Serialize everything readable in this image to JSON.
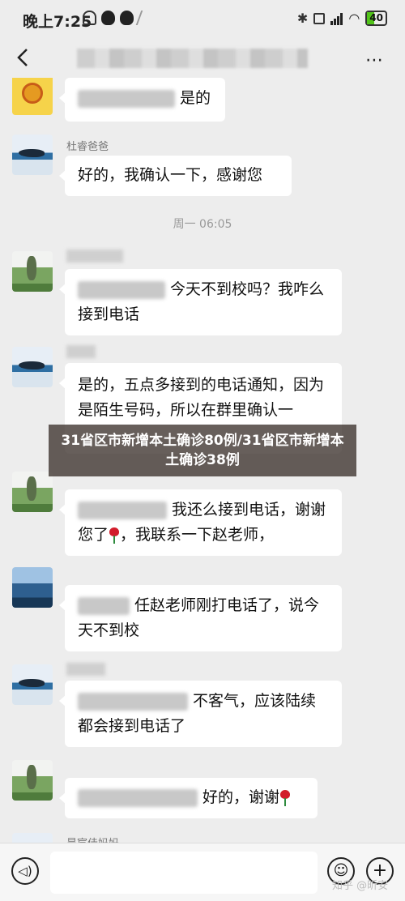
{
  "status_bar": {
    "time": "晚上7:25",
    "battery": "40"
  },
  "header": {
    "more_icon": "⋯"
  },
  "messages": [
    {
      "sender": "",
      "text_tail": "是的"
    },
    {
      "sender": "杜睿爸爸",
      "text": "好的，我确认一下，感谢您"
    },
    {
      "sender": "",
      "text_tail": "今天不到校吗？我咋么接到电话"
    },
    {
      "sender": "",
      "text": "是的，五点多接到的电话通知，因为是陌生号码，所以在群里确认一"
    },
    {
      "sender": "",
      "text_tail": "我还么接到电话，谢谢您了",
      "text_tail2": "，我联系一下赵老师，"
    },
    {
      "sender": "",
      "text_tail": "任赵老师刚打电话了，说今天不到校"
    },
    {
      "sender": "",
      "text_tail": "不客气，应该陆续都会接到电话了"
    },
    {
      "sender": "",
      "text_tail": "好的，谢谢"
    },
    {
      "sender": "昊宸佳妈妈"
    }
  ],
  "timestamp": "周一 06:05",
  "banner": "31省区市新增本土确诊80例/31省区市新增本土确诊38例",
  "watermark": "知乎 @昕安",
  "icons": {
    "back": "chevron-left-icon",
    "voice": "voice-icon",
    "emoji": "emoji-icon",
    "plus": "plus-icon"
  }
}
